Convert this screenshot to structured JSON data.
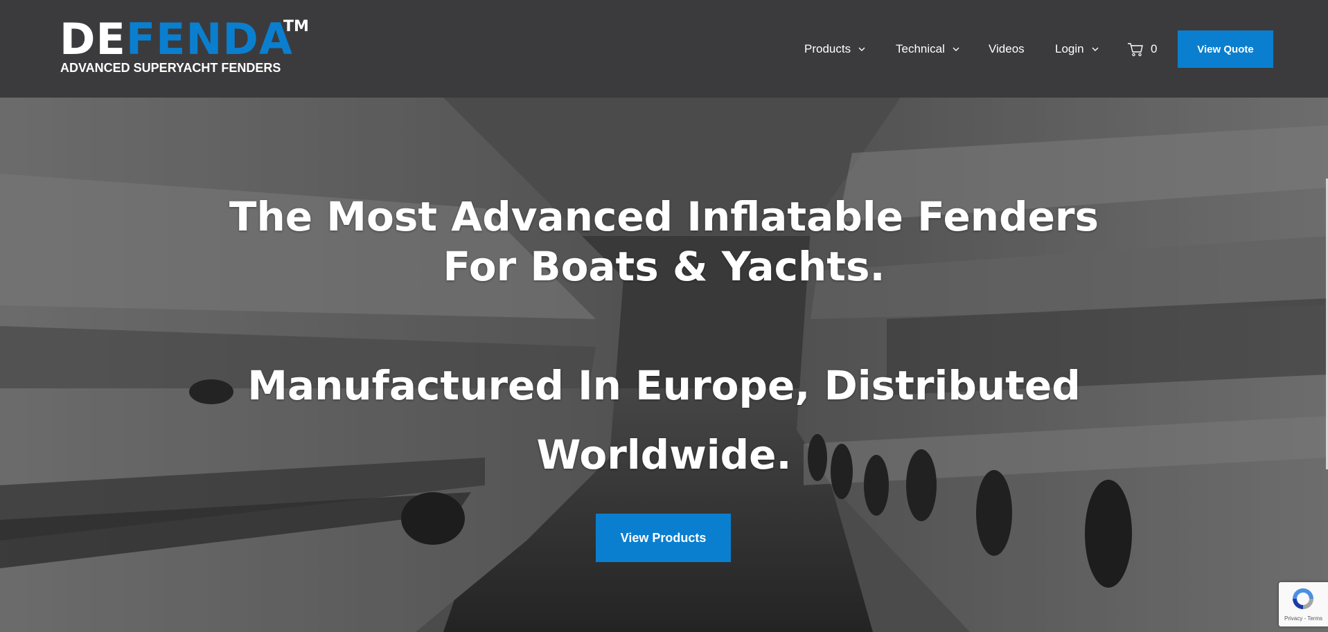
{
  "header": {
    "logo": {
      "word_part1": "DE",
      "word_part2": "FENDA",
      "trademark": "TM",
      "tagline": "ADVANCED SUPERYACHT FENDERS",
      "brand_color": "#0a7fd0"
    },
    "nav": {
      "products": {
        "label": "Products",
        "icon": "chevron-down-icon"
      },
      "technical": {
        "label": "Technical",
        "icon": "chevron-down-icon"
      },
      "videos": {
        "label": "Videos"
      },
      "login": {
        "label": "Login",
        "icon": "chevron-down-icon"
      },
      "cart": {
        "icon": "cart-icon",
        "count": "0"
      }
    },
    "quote_button": "View Quote",
    "background_color": "#3b3b3d"
  },
  "hero": {
    "headline_line1": "The Most Advanced Inflatable Fenders",
    "headline_line2": "For Boats & Yachts.",
    "subheadline_line1": "Manufactured In Europe, Distributed",
    "subheadline_line2": "Worldwide.",
    "cta_button": "View Products",
    "accent_color": "#0a7fd0"
  },
  "recaptcha": {
    "icon": "recaptcha-icon",
    "links": "Privacy - Terms"
  }
}
